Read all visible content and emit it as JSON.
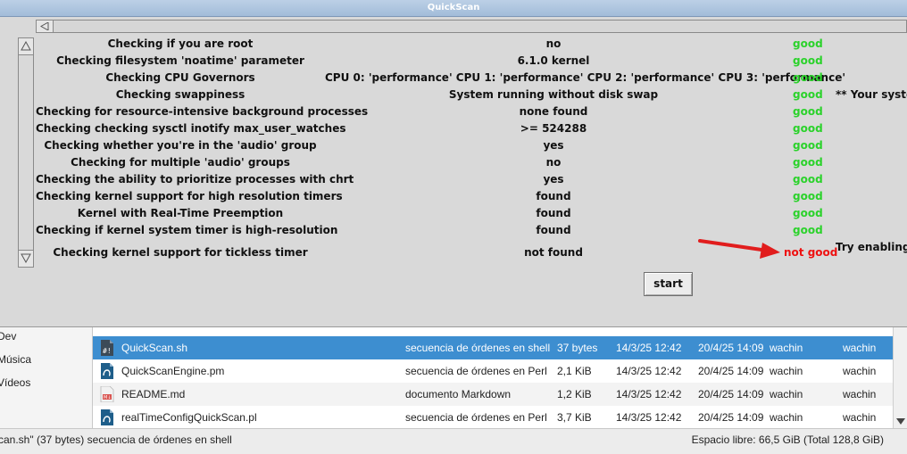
{
  "window": {
    "title": "QuickScan"
  },
  "checks": [
    {
      "check": "Checking if you are root",
      "value": "no",
      "status": "good",
      "extra": ""
    },
    {
      "check": "Checking filesystem 'noatime' parameter",
      "value": "6.1.0 kernel",
      "status": "good",
      "extra": ""
    },
    {
      "check": "Checking CPU Governors",
      "value": "CPU 0: 'performance' CPU 1: 'performance' CPU 2: 'performance' CPU 3: 'performance'",
      "status": "good",
      "extra": ""
    },
    {
      "check": "Checking swappiness",
      "value": "System running without disk swap",
      "status": "good",
      "extra": "** Your system"
    },
    {
      "check": "Checking for resource-intensive background processes",
      "value": "none found",
      "status": "good",
      "extra": ""
    },
    {
      "check": "Checking checking sysctl inotify max_user_watches",
      "value": ">= 524288",
      "status": "good",
      "extra": ""
    },
    {
      "check": "Checking whether you're in the 'audio' group",
      "value": "yes",
      "status": "good",
      "extra": ""
    },
    {
      "check": "Checking for multiple 'audio' groups",
      "value": "no",
      "status": "good",
      "extra": ""
    },
    {
      "check": "Checking the ability to prioritize processes with chrt",
      "value": "yes",
      "status": "good",
      "extra": ""
    },
    {
      "check": "Checking kernel support for high resolution timers",
      "value": "found",
      "status": "good",
      "extra": ""
    },
    {
      "check": "Kernel with Real-Time Preemption",
      "value": "found",
      "status": "good",
      "extra": ""
    },
    {
      "check": "Checking if kernel system timer is high-resolution",
      "value": "found",
      "status": "good",
      "extra": ""
    },
    {
      "check": "Checking kernel support for tickless timer",
      "value": "not found",
      "status": "not good",
      "extra": "Try enabling tic"
    }
  ],
  "start_label": "start",
  "file_manager": {
    "sidebar": [
      "Dev",
      "Música",
      "Vídeos"
    ],
    "files": [
      {
        "name": "QuickScan.sh",
        "type": "secuencia de órdenes en shell",
        "size": "37 bytes",
        "modified": "14/3/25 12:42",
        "accessed": "20/4/25 14:09",
        "owner": "wachin",
        "group": "wachin",
        "icon": "shell-script-icon"
      },
      {
        "name": "QuickScanEngine.pm",
        "type": "secuencia de órdenes en Perl",
        "size": "2,1 KiB",
        "modified": "14/3/25 12:42",
        "accessed": "20/4/25 14:09",
        "owner": "wachin",
        "group": "wachin",
        "icon": "perl-script-icon"
      },
      {
        "name": "README.md",
        "type": "documento Markdown",
        "size": "1,2 KiB",
        "modified": "14/3/25 12:42",
        "accessed": "20/4/25 14:09",
        "owner": "wachin",
        "group": "wachin",
        "icon": "markdown-file-icon"
      },
      {
        "name": "realTimeConfigQuickScan.pl",
        "type": "secuencia de órdenes en Perl",
        "size": "3,7 KiB",
        "modified": "14/3/25 12:42",
        "accessed": "20/4/25 14:09",
        "owner": "wachin",
        "group": "wachin",
        "icon": "perl-script-icon"
      }
    ],
    "status_left": "can.sh\" (37 bytes) secuencia de órdenes en shell",
    "status_right": "Espacio libre: 66,5 GiB (Total 128,8 GiB)"
  },
  "colors": {
    "good": "#2bd22b",
    "bad": "#ee1111",
    "selection": "#3d8ed0",
    "arrow": "#e11d1d"
  }
}
